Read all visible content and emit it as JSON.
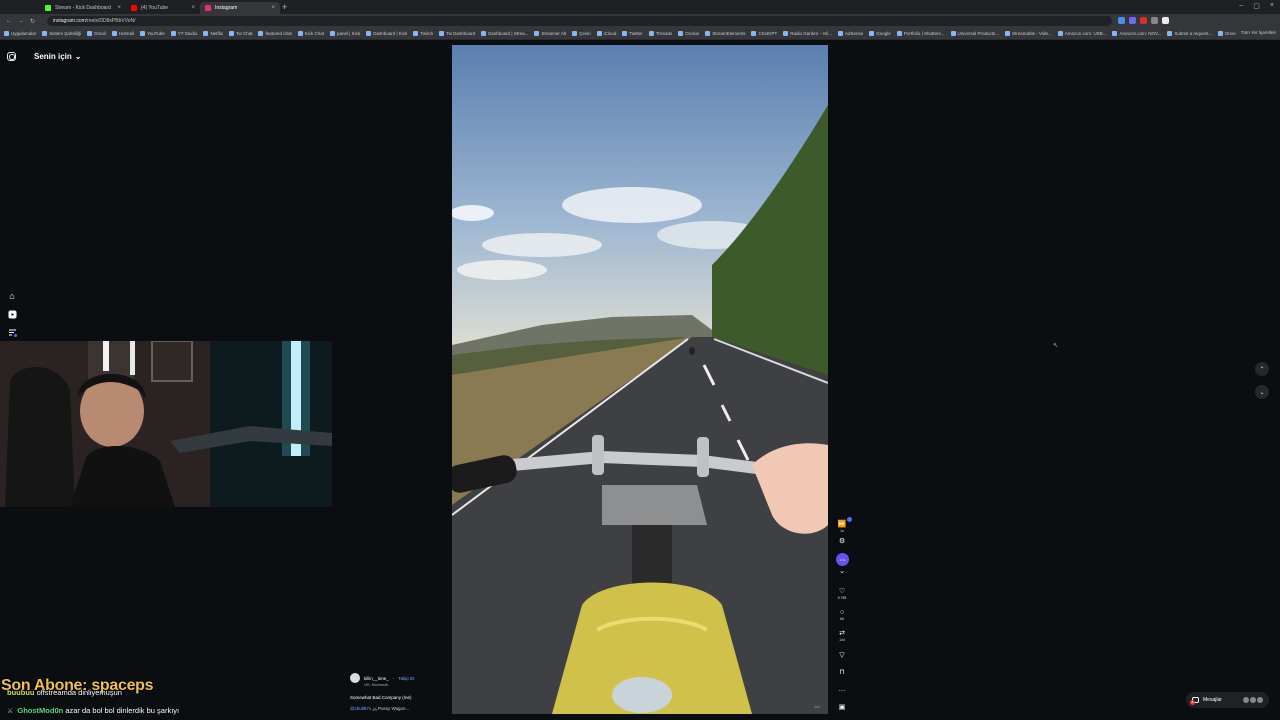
{
  "browser": {
    "tabs": [
      {
        "label": "Stream - Kick Dashboard",
        "color": "#53fc18",
        "active": false
      },
      {
        "label": "(4) YouTube",
        "color": "#ff0000",
        "active": false
      },
      {
        "label": "Instagram",
        "color": "#e1306c",
        "active": true
      }
    ],
    "new_tab": "+",
    "url_host": "instagram.com",
    "url_path": "/reels/DD8xPBbVVoN/",
    "bookmarks": [
      "Uygulamalar",
      "Sistem Şahsiliği",
      "Gmail",
      "Hotmail",
      "YouTube",
      "YT Studio",
      "Netflix",
      "Tw Chat",
      "featured chat",
      "Kick Chat",
      "panel | Kick",
      "Dashboard | Kick",
      "Twitch",
      "Tw Dashboard",
      "Dashboard | Strea...",
      "Streamer Alt",
      "Çeviri",
      "iCloud",
      "Twitter",
      "Threads",
      "Oculus",
      "StreamElements",
      "ChatGPT",
      "Radio Garden – Kli...",
      "AdSense",
      "Google",
      "Portfolio | Shutters...",
      "Universal Products...",
      "Streamable - Vide...",
      "Amazon.com: USB...",
      "Amazon.com: NOV...",
      "Submit a request...",
      "Drive & Listen"
    ],
    "all_bookmarks": "Tüm Yer İşaretleri"
  },
  "feed": {
    "title": "Senin için",
    "chevron": "⌄"
  },
  "reel": {
    "author": "killin__time_",
    "follow_label": "Takip Et",
    "location": "UIK, Monmouth",
    "song": "Somewhat Bad Company (me)",
    "tag_user": "@cbull97x",
    "tag_text": "🚲Pussy Wagon..."
  },
  "actions": {
    "likes": "9.785",
    "comments": "66",
    "reposts": "144",
    "speed": "1x",
    "purple_label": "1.5x"
  },
  "messages": {
    "label": "Mesajlar",
    "count": "8"
  },
  "overlay": {
    "title": "Son Abone: spaceps",
    "chat": [
      {
        "user": "buubuu",
        "text": "offstreamda dinliyemuşun"
      },
      {
        "user": "GhostMod0n",
        "text": "azar da bol bol dinlerdik bu şarkıyı"
      }
    ]
  }
}
